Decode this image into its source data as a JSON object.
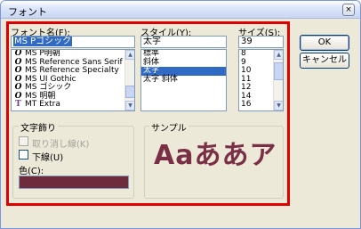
{
  "window": {
    "title": "フォント",
    "close_glyph": "×"
  },
  "font": {
    "label": "フォント名(F):",
    "value": "MS Pゴシック",
    "items": [
      {
        "label": "MS P明朝",
        "icon": "opentype-icon"
      },
      {
        "label": "MS Reference Sans Serif",
        "icon": "opentype-icon"
      },
      {
        "label": "MS Reference Specialty",
        "icon": "opentype-icon"
      },
      {
        "label": "MS UI Gothic",
        "icon": "opentype-icon"
      },
      {
        "label": "MS ゴシック",
        "icon": "opentype-icon"
      },
      {
        "label": "MS 明朝",
        "icon": "opentype-icon"
      },
      {
        "label": "MT Extra",
        "icon": "truetype-icon"
      }
    ]
  },
  "style": {
    "label": "スタイル(Y):",
    "value": "太字",
    "items": [
      "標準",
      "斜体",
      "太字",
      "太字 斜体"
    ],
    "selected_index": 2
  },
  "size": {
    "label": "サイズ(S):",
    "value": "39",
    "items": [
      "8",
      "9",
      "10",
      "11",
      "12",
      "14",
      "16"
    ]
  },
  "buttons": {
    "ok": "OK",
    "cancel": "キャンセル"
  },
  "effects": {
    "label": "文字飾り",
    "strikethrough": "取り消し線(K)",
    "underline": "下線(U)",
    "color_label": "色(C):",
    "color_value": "#6e2b3e"
  },
  "sample": {
    "label": "サンプル",
    "text": "Aaああア"
  },
  "icons": {
    "opentype": "O",
    "truetype": "T",
    "scroll_up": "▲",
    "scroll_down": "▼"
  }
}
